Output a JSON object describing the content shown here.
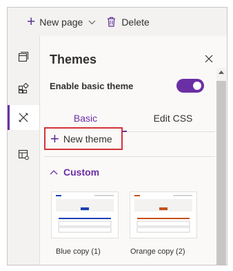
{
  "toolbar": {
    "new_page_label": "New page",
    "delete_label": "Delete"
  },
  "rail": {
    "items": [
      "pages-icon",
      "components-icon",
      "themes-icon",
      "templates-icon"
    ],
    "active": "themes-icon"
  },
  "panel": {
    "title": "Themes",
    "toggle_label": "Enable basic theme",
    "toggle_on": true,
    "tabs": [
      {
        "label": "Basic",
        "selected": true
      },
      {
        "label": "Edit CSS",
        "selected": false
      }
    ],
    "new_theme_label": "New theme",
    "section_label": "Custom",
    "themes": [
      {
        "name": "Blue copy (1)",
        "accent": "#1a3fb5"
      },
      {
        "name": "Orange copy (2)",
        "accent": "#c5501a"
      }
    ]
  },
  "colors": {
    "accent": "#6b2fa5",
    "highlight_border": "#d13438"
  }
}
